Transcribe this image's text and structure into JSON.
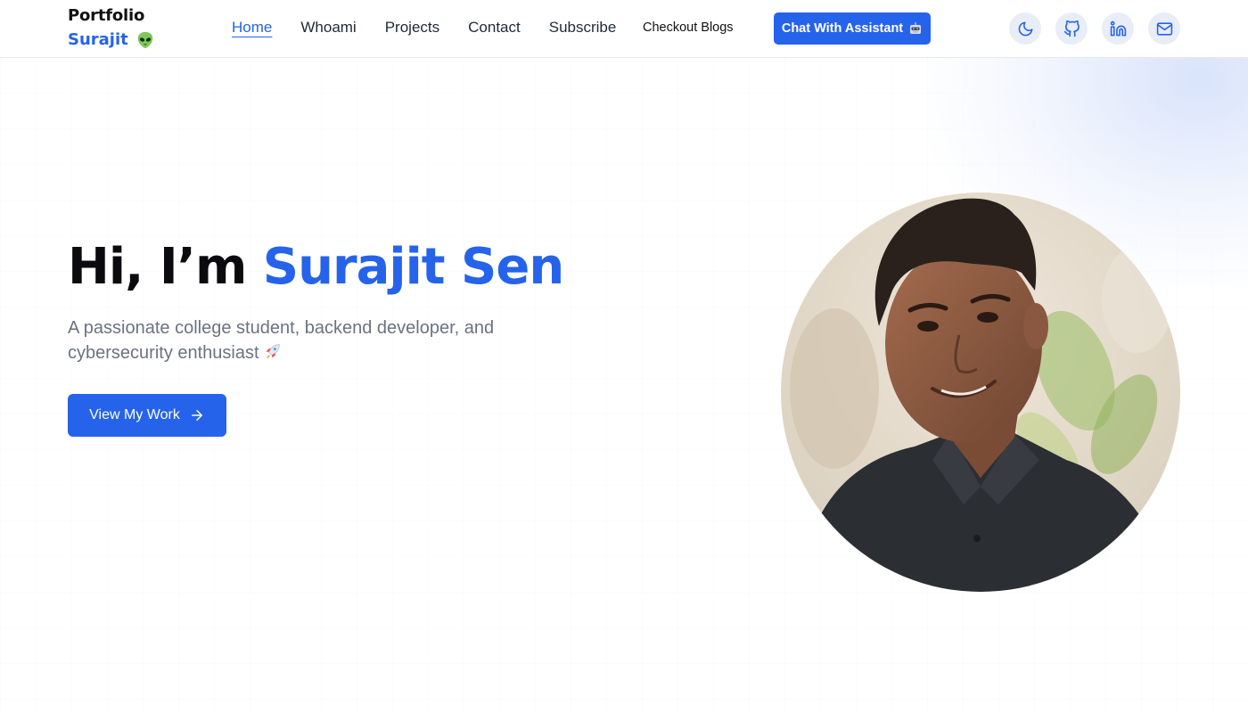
{
  "brand": {
    "title": "Portfolio",
    "name": "Surajit"
  },
  "nav": {
    "links": [
      {
        "label": "Home",
        "active": true
      },
      {
        "label": "Whoami",
        "active": false
      },
      {
        "label": "Projects",
        "active": false
      },
      {
        "label": "Contact",
        "active": false
      },
      {
        "label": "Subscribe",
        "active": false
      }
    ],
    "blogs_label": "Checkout Blogs",
    "chat_label": "Chat With Assistant",
    "icons": [
      "moon-icon",
      "github-icon",
      "linkedin-icon",
      "mail-icon"
    ]
  },
  "hero": {
    "greeting": "Hi, I’m ",
    "name": "Surajit Sen",
    "subtitle": "A passionate college student, backend developer, and cybersecurity enthusiast",
    "cta_label": "View My Work"
  },
  "colors": {
    "accent": "#2563eb",
    "text": "#0b0b0f",
    "muted": "#6b7280",
    "icon_bg": "#e8edf8"
  }
}
